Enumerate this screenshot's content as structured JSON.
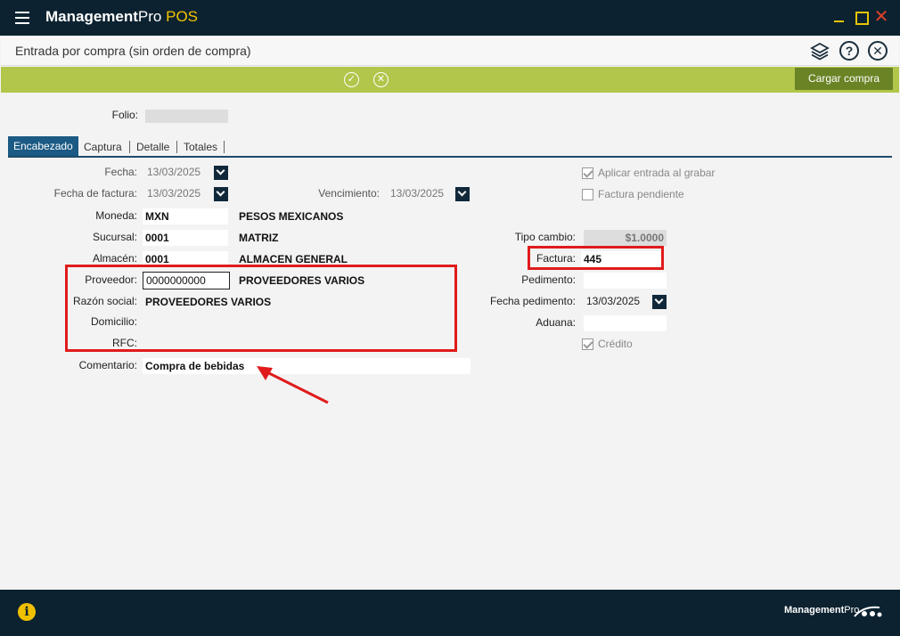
{
  "app": {
    "brand_bold": "Management",
    "brand_pro": "Pro",
    "brand_pos": " POS"
  },
  "window": {
    "title": "Entrada por compra (sin orden de compra)"
  },
  "toolbar": {
    "cargar_label": "Cargar compra"
  },
  "folio": {
    "label": "Folio:",
    "value": ""
  },
  "tabs": [
    {
      "label": "Encabezado"
    },
    {
      "label": "Captura"
    },
    {
      "label": "Detalle"
    },
    {
      "label": "Totales"
    }
  ],
  "form": {
    "fecha": {
      "label": "Fecha:",
      "value": "13/03/2025"
    },
    "fecha_factura": {
      "label": "Fecha de factura:",
      "value": "13/03/2025"
    },
    "vencimiento": {
      "label": "Vencimiento:",
      "value": "13/03/2025"
    },
    "moneda": {
      "label": "Moneda:",
      "code": "MXN",
      "name": "PESOS MEXICANOS"
    },
    "sucursal": {
      "label": "Sucursal:",
      "code": "0001",
      "name": "MATRIZ"
    },
    "almacen": {
      "label": "Almacén:",
      "code": "0001",
      "name": "ALMACEN GENERAL"
    },
    "proveedor": {
      "label": "Proveedor:",
      "code": "0000000000",
      "name": "PROVEEDORES VARIOS"
    },
    "razon_social": {
      "label": "Razón social:",
      "value": "PROVEEDORES VARIOS"
    },
    "domicilio": {
      "label": "Domicilio:",
      "value": ""
    },
    "rfc": {
      "label": "RFC:",
      "value": ""
    },
    "comentario": {
      "label": "Comentario:",
      "value": "Compra de bebidas"
    },
    "aplicar": {
      "label": "Aplicar entrada al grabar",
      "checked": true
    },
    "factura_pendiente": {
      "label": "Factura pendiente",
      "checked": false
    },
    "tipo_cambio": {
      "label": "Tipo cambio:",
      "value": "$1.0000"
    },
    "factura": {
      "label": "Factura:",
      "value": "445"
    },
    "pedimento": {
      "label": "Pedimento:",
      "value": ""
    },
    "fecha_pedimento": {
      "label": "Fecha pedimento:",
      "value": "13/03/2025"
    },
    "aduana": {
      "label": "Aduana:",
      "value": ""
    },
    "credito": {
      "label": "Crédito",
      "checked": true
    }
  },
  "footer": {
    "brand_bold": "Management",
    "brand_pro": "Pro"
  },
  "colors": {
    "titlebar": "#0c2230",
    "accent_green": "#b1c64b",
    "button_green": "#6a8325",
    "tab_active": "#1b5a84",
    "highlight_red": "#e01b1b",
    "pos_yellow": "#f2c500"
  }
}
